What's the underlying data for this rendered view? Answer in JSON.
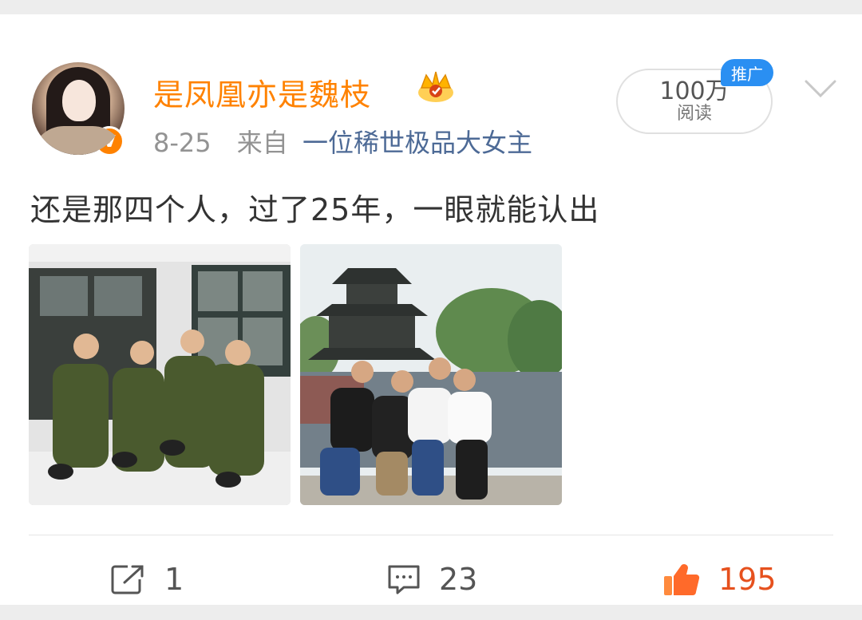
{
  "post": {
    "username": "是凤凰亦是魏枝",
    "date": "8-25",
    "source_prefix": "来自",
    "source": "一位稀世极品大女主",
    "text": "还是那四个人，过了25年，一眼就能认出",
    "read_count": "100万",
    "read_label": "阅读",
    "promo_badge": "推广",
    "verified_badge": "V",
    "images": [
      "photo-military-group",
      "photo-pavilion-group"
    ]
  },
  "actions": {
    "share_count": "1",
    "comment_count": "23",
    "like_count": "195"
  },
  "colors": {
    "username": "#ff8200",
    "source_link": "#4d6a96",
    "meta": "#939393",
    "like": "#e6511e",
    "promo_badge": "#2a8ff2"
  },
  "icons": [
    "verified-icon",
    "crown-icon",
    "chevron-down-icon",
    "share-icon",
    "comment-icon",
    "like-icon"
  ]
}
